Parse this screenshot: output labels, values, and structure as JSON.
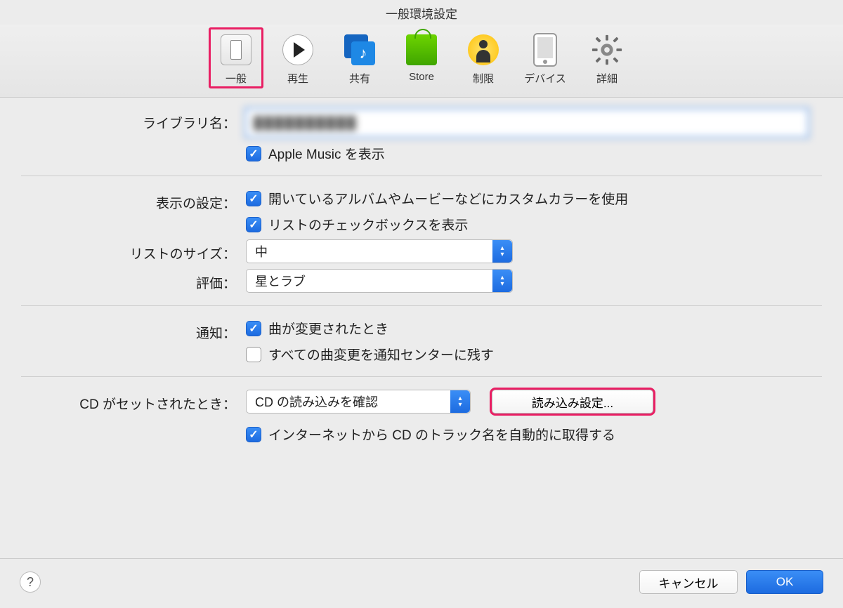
{
  "window": {
    "title": "一般環境設定"
  },
  "toolbar": {
    "items": [
      {
        "label": "一般"
      },
      {
        "label": "再生"
      },
      {
        "label": "共有"
      },
      {
        "label": "Store"
      },
      {
        "label": "制限"
      },
      {
        "label": "デバイス"
      },
      {
        "label": "詳細"
      }
    ]
  },
  "form": {
    "library": {
      "label": "ライブラリ名：",
      "value": "██████████",
      "show_apple_music": "Apple Music を表示"
    },
    "display": {
      "label": "表示の設定：",
      "custom_colors": "開いているアルバムやムービーなどにカスタムカラーを使用",
      "list_checkboxes": "リストのチェックボックスを表示"
    },
    "list_size": {
      "label": "リストのサイズ：",
      "value": "中"
    },
    "rating": {
      "label": "評価：",
      "value": "星とラブ"
    },
    "notifications": {
      "label": "通知：",
      "song_change": "曲が変更されたとき",
      "keep_all": "すべての曲変更を通知センターに残す"
    },
    "cd": {
      "label": "CD がセットされたとき：",
      "action": "CD の読み込みを確認",
      "import_settings": "読み込み設定...",
      "auto_track_names": "インターネットから CD のトラック名を自動的に取得する"
    }
  },
  "footer": {
    "cancel": "キャンセル",
    "ok": "OK"
  }
}
